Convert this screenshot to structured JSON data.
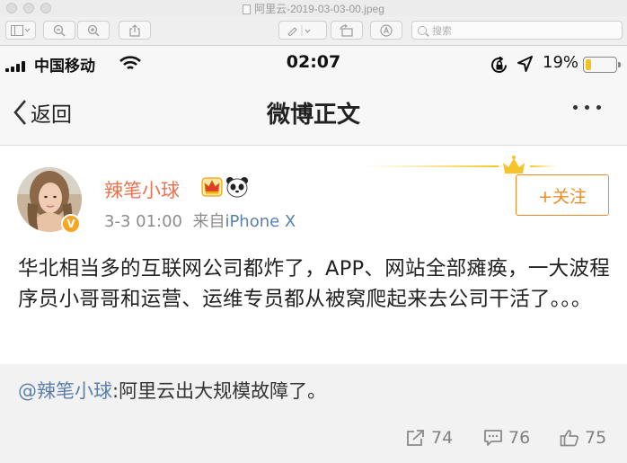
{
  "window": {
    "title": "阿里云-2019-03-03-00.jpeg",
    "search_placeholder": "搜索"
  },
  "status_bar": {
    "carrier": "中国移动",
    "time": "02:07",
    "battery_percent": "19%",
    "battery_level": 0.19,
    "battery_color": "#f4c022"
  },
  "nav": {
    "back_label": "返回",
    "title": "微博正文"
  },
  "post": {
    "username": "辣笔小球",
    "timestamp": "3-3 01:00",
    "source_prefix": "来自",
    "source": "iPhone X",
    "follow_label": "+关注",
    "text": "华北相当多的互联网公司都炸了，APP、网站全部瘫痪，一大波程序员小哥哥和运营、运维专员都从被窝爬起来去公司干活了。。。",
    "verified_mark": "V",
    "accent_color": "#eb7350"
  },
  "repost": {
    "mention": "@辣笔小球",
    "text": ":阿里云出大规模故障了。"
  },
  "actions": {
    "share_count": "74",
    "comment_count": "76",
    "like_count": "75"
  }
}
